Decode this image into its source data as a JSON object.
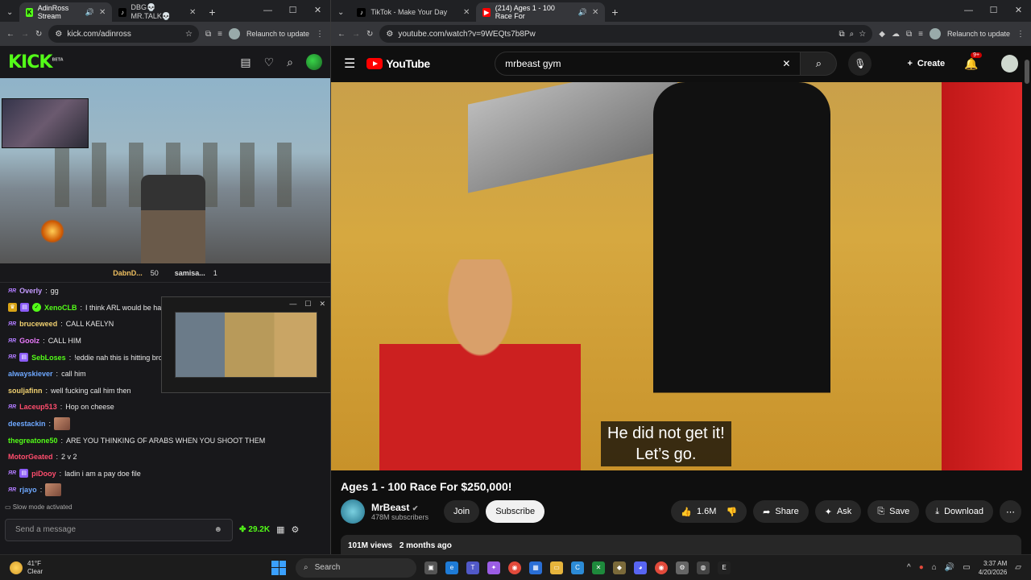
{
  "left_browser": {
    "tabs": [
      {
        "label": "AdinRoss Stream",
        "icon": "kick-favicon",
        "active": true
      },
      {
        "label": "DBG💀MR.TALK💀",
        "icon": "tiktok-favicon",
        "active": false
      }
    ],
    "url": "kick.com/adinross",
    "relaunch": "Relaunch to update"
  },
  "kick": {
    "logo": "KICK",
    "logo_sup": "BETA",
    "viewers": [
      {
        "name": "DabnD...",
        "count": "50"
      },
      {
        "name": "samisa...",
        "count": "1"
      }
    ],
    "chat": [
      {
        "badges": [
          "ar"
        ],
        "user": "Overly",
        "color": "#c59bff",
        "msg": "gg"
      },
      {
        "badges": [
          "crown",
          "sub",
          "verified"
        ],
        "user": "XenoCLB",
        "color": "#53fc18",
        "msg": "I think ARL would be hap"
      },
      {
        "badges": [
          "ar"
        ],
        "user": "bruceweed",
        "color": "#f0d070",
        "msg": "CALL KAELYN"
      },
      {
        "badges": [
          "ar"
        ],
        "user": "Goolz",
        "color": "#e879f9",
        "msg": "CALL HIM"
      },
      {
        "badges": [
          "ar",
          "sub"
        ],
        "user": "SebLoses",
        "color": "#53fc18",
        "msg": "!eddie nah this is hitting bro"
      },
      {
        "badges": [],
        "user": "alwayskiever",
        "color": "#6ea8ff",
        "msg": "call him"
      },
      {
        "badges": [],
        "user": "souljafinn",
        "color": "#f0d070",
        "msg": "well fucking call him then"
      },
      {
        "badges": [
          "ar"
        ],
        "user": "Laceup513",
        "color": "#ff4d6d",
        "msg": "Hop on cheese"
      },
      {
        "badges": [],
        "user": "deestackin",
        "color": "#6ea8ff",
        "msg": "",
        "emote": true
      },
      {
        "badges": [],
        "user": "thegreatone50",
        "color": "#53fc18",
        "msg": "ARE YOU THINKING OF ARABS WHEN YOU SHOOT THEM"
      },
      {
        "badges": [],
        "user": "MotorGeated",
        "color": "#ff4d6d",
        "msg": "2 v 2"
      },
      {
        "badges": [
          "ar",
          "sub"
        ],
        "user": "piDooy",
        "color": "#ff4d6d",
        "msg": "ladin i am a pay doe file"
      },
      {
        "badges": [
          "ar"
        ],
        "user": "rjayo",
        "color": "#6ea8ff",
        "msg": "",
        "emote": true
      }
    ],
    "slow_mode": "Slow mode activated",
    "input_placeholder": "Send a message",
    "points": "29.2K"
  },
  "right_browser": {
    "tabs": [
      {
        "label": "TikTok - Make Your Day",
        "icon": "tiktok-favicon",
        "active": false
      },
      {
        "label": "(214) Ages 1 - 100 Race For",
        "icon": "youtube-favicon",
        "active": true
      }
    ],
    "url": "youtube.com/watch?v=9WEQts7b8Pw",
    "relaunch": "Relaunch to update"
  },
  "youtube": {
    "logo": "YouTube",
    "search_value": "mrbeast gym",
    "create_label": "Create",
    "notif_count": "9+",
    "caption_line1": "He did not get it!",
    "caption_line2": "Let’s go.",
    "video_title": "Ages 1 - 100 Race For $250,000!",
    "channel": "MrBeast",
    "subscribers": "478M subscribers",
    "join": "Join",
    "subscribe": "Subscribe",
    "likes": "1.6M",
    "share": "Share",
    "ask": "Ask",
    "save": "Save",
    "download": "Download",
    "views": "101M views",
    "age": "2 months ago"
  },
  "taskbar": {
    "temp": "41°F",
    "weather": "Clear",
    "search": "Search",
    "time": "3:37 AM",
    "date": "4/20/2026"
  }
}
